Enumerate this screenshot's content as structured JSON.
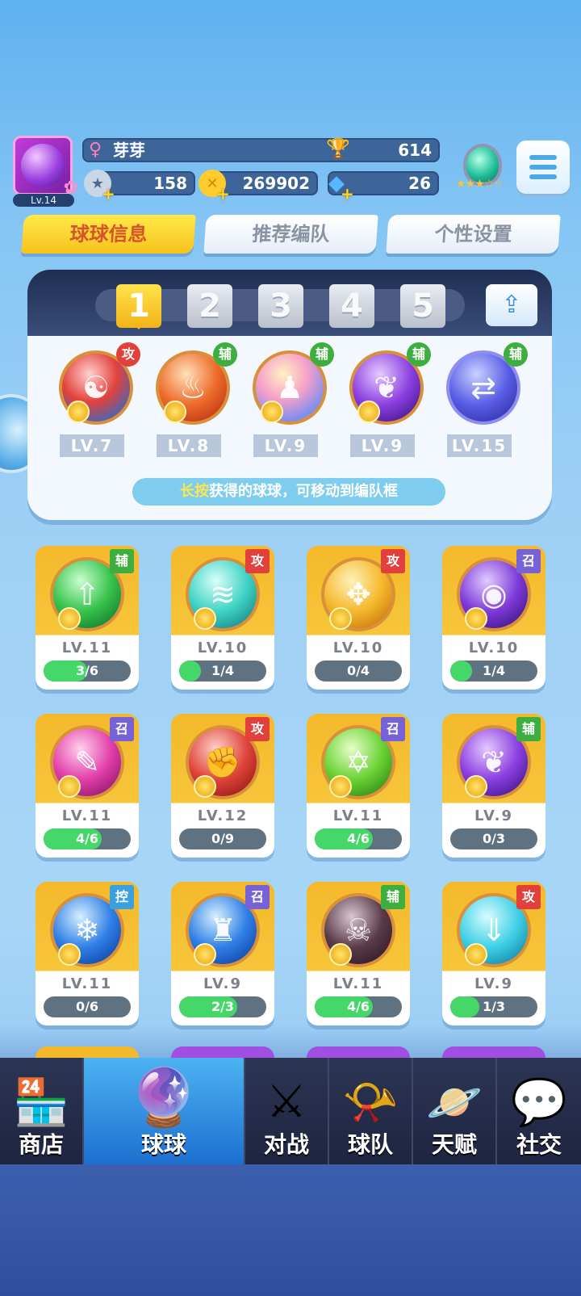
{
  "player": {
    "level_label": "Lv.14",
    "name": "芽芽",
    "gender_symbol": "♀",
    "trophies": "614",
    "stamina": "158",
    "gold": "269902",
    "gems": "26"
  },
  "tabs": [
    {
      "label": "球球信息",
      "active": true
    },
    {
      "label": "推荐编队",
      "active": false
    },
    {
      "label": "个性设置",
      "active": false
    }
  ],
  "team": {
    "slots": [
      "1",
      "2",
      "3",
      "4",
      "5"
    ],
    "selected_slot": "1",
    "members": [
      {
        "type": "攻",
        "level": "LV.7"
      },
      {
        "type": "辅",
        "level": "LV.8"
      },
      {
        "type": "辅",
        "level": "LV.9"
      },
      {
        "type": "辅",
        "level": "LV.9"
      },
      {
        "type": "辅",
        "level": "LV.15"
      }
    ],
    "hint_highlight": "长按",
    "hint_text": "获得的球球，可移动到编队框"
  },
  "balls": [
    {
      "type": "辅",
      "level": "LV.11",
      "progress": "3/6"
    },
    {
      "type": "攻",
      "level": "LV.10",
      "progress": "1/4"
    },
    {
      "type": "攻",
      "level": "LV.10",
      "progress": "0/4"
    },
    {
      "type": "召",
      "level": "LV.10",
      "progress": "1/4"
    },
    {
      "type": "召",
      "level": "LV.11",
      "progress": "4/6"
    },
    {
      "type": "攻",
      "level": "LV.12",
      "progress": "0/9"
    },
    {
      "type": "召",
      "level": "LV.11",
      "progress": "4/6"
    },
    {
      "type": "辅",
      "level": "LV.9",
      "progress": "0/3"
    },
    {
      "type": "控",
      "level": "LV.11",
      "progress": "0/6"
    },
    {
      "type": "召",
      "level": "LV.9",
      "progress": "2/3"
    },
    {
      "type": "辅",
      "level": "LV.11",
      "progress": "4/6"
    },
    {
      "type": "攻",
      "level": "LV.9",
      "progress": "1/3"
    }
  ],
  "nav": [
    {
      "label": "商店",
      "icon": "shop-icon",
      "active": false
    },
    {
      "label": "球球",
      "icon": "ball-icon",
      "active": true
    },
    {
      "label": "对战",
      "icon": "swords-icon",
      "active": false
    },
    {
      "label": "球队",
      "icon": "whistle-icon",
      "active": false
    },
    {
      "label": "天赋",
      "icon": "planet-icon",
      "active": false
    },
    {
      "label": "社交",
      "icon": "chat-icon",
      "active": false
    }
  ],
  "colors": {
    "attack": "#e2413b",
    "support": "#3dae3f",
    "summon": "#7661d6",
    "control": "#3aa0e0",
    "progress": "#45d869"
  }
}
